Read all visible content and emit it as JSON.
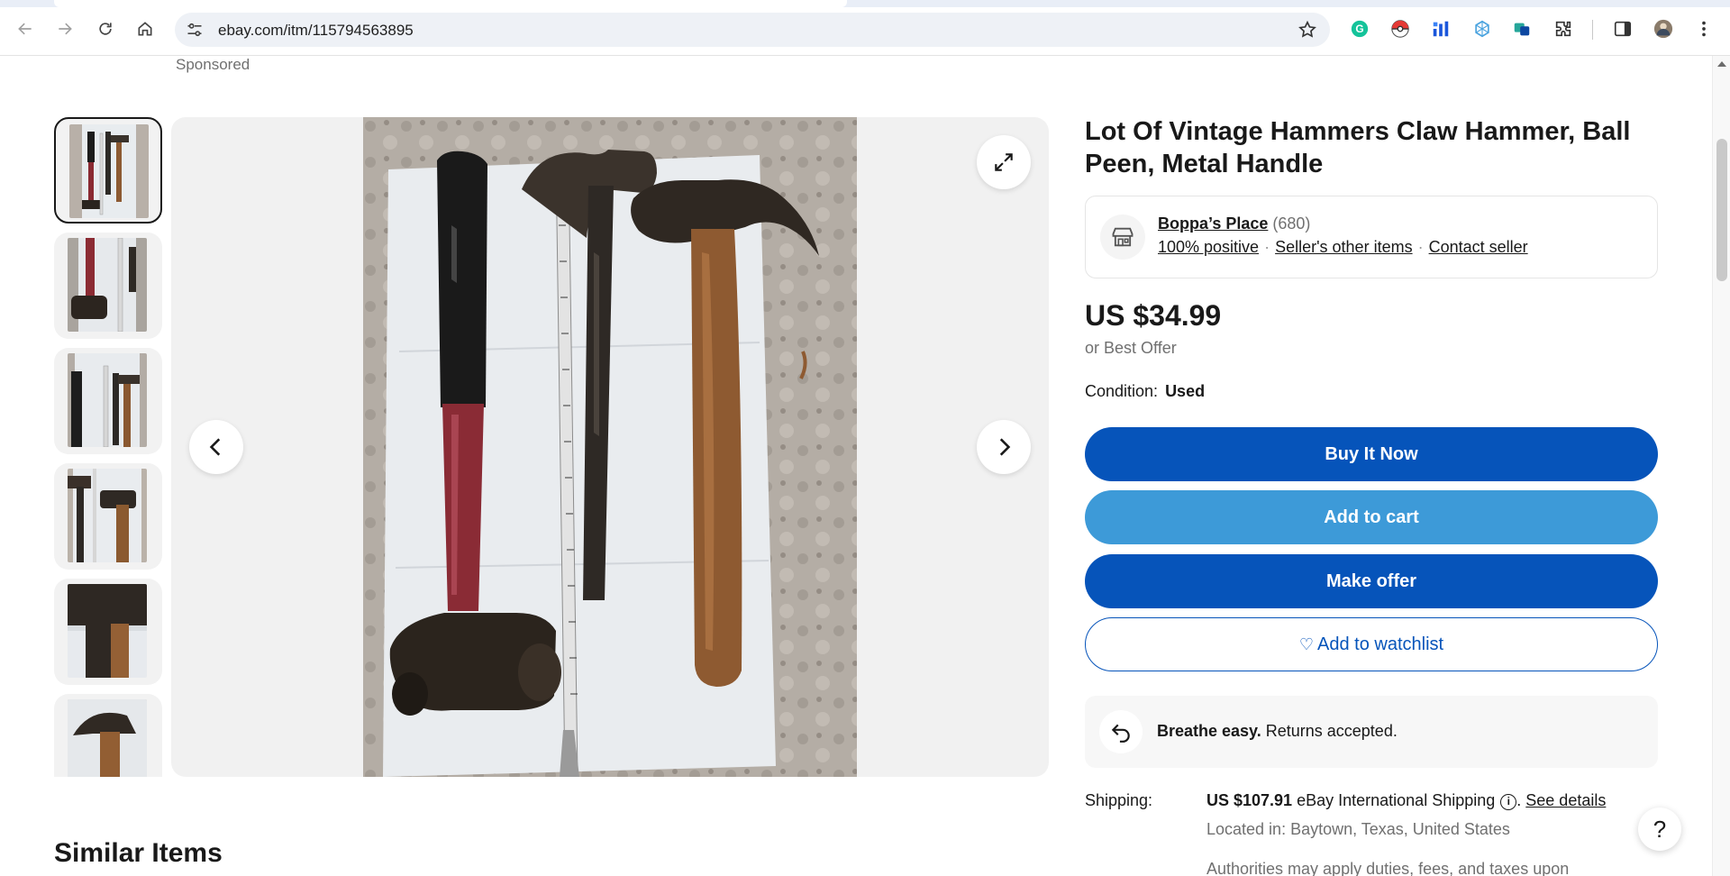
{
  "browser": {
    "url": "ebay.com/itm/115794563895"
  },
  "page": {
    "sponsored": "Sponsored",
    "similar_heading": "Similar Items"
  },
  "listing": {
    "title": "Lot Of Vintage Hammers Claw Hammer, Ball Peen, Metal Handle",
    "seller": {
      "name": "Boppa’s Place",
      "feedback_count": "(680)",
      "positive": "100% positive",
      "other_items": "Seller's other items",
      "contact": "Contact seller"
    },
    "price": "US $34.99",
    "best_offer": "or Best Offer",
    "condition_label": "Condition:",
    "condition_value": "Used",
    "buttons": {
      "buy_now": "Buy It Now",
      "add_to_cart": "Add to cart",
      "make_offer": "Make offer",
      "watchlist": "Add to watchlist"
    },
    "returns": {
      "bold": "Breathe easy.",
      "text": "Returns accepted."
    },
    "shipping": {
      "label": "Shipping:",
      "cost": "US $107.91",
      "method": "eBay International Shipping",
      "details_link": "See details",
      "located": "Located in: Baytown, Texas, United States",
      "duties": "Authorities may apply duties, fees, and taxes upon"
    }
  },
  "colors": {
    "primary_blue": "#0654ba",
    "secondary_blue": "#3d9ad8"
  },
  "icons": [
    "back-icon",
    "forward-icon",
    "reload-icon",
    "home-icon",
    "site-info-icon",
    "bookmark-star-icon",
    "expand-icon",
    "chevron-left-icon",
    "chevron-right-icon",
    "store-icon",
    "heart-icon",
    "return-icon",
    "info-icon",
    "help-icon"
  ]
}
